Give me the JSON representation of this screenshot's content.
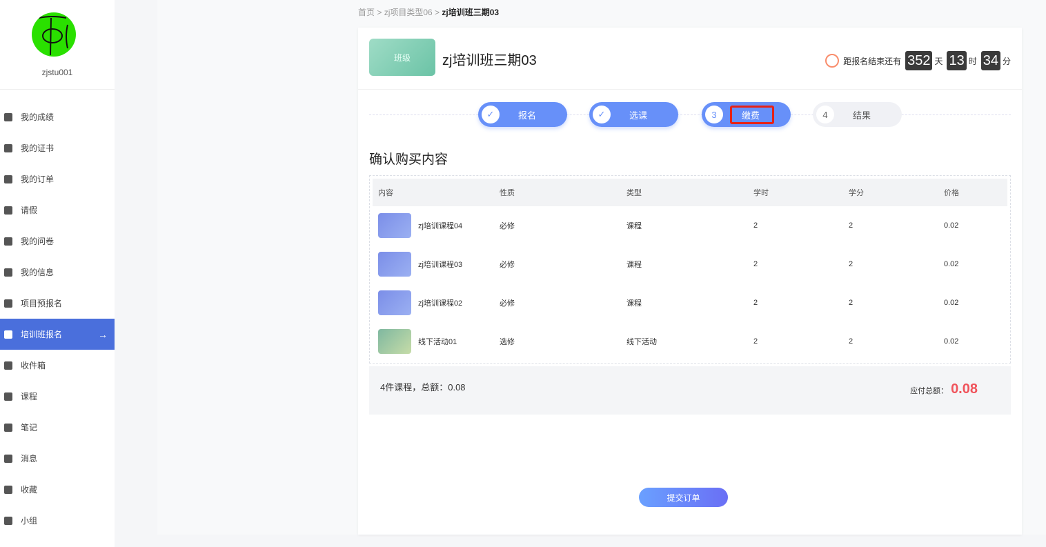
{
  "user": {
    "name": "zjstu001"
  },
  "sidebar": {
    "items": [
      {
        "label": "我的成绩"
      },
      {
        "label": "我的证书"
      },
      {
        "label": "我的订单"
      },
      {
        "label": "请假"
      },
      {
        "label": "我的问卷"
      },
      {
        "label": "我的信息"
      },
      {
        "label": "项目预报名"
      },
      {
        "label": "培训班报名",
        "active": true
      },
      {
        "label": "收件箱"
      },
      {
        "label": "课程"
      },
      {
        "label": "笔记"
      },
      {
        "label": "消息"
      },
      {
        "label": "收藏"
      },
      {
        "label": "小组"
      }
    ]
  },
  "breadcrumb": [
    "首页",
    "zj项目类型06",
    "zj培训班三期03"
  ],
  "class": {
    "thumb_label": "班级",
    "title": "zj培训班三期03"
  },
  "countdown": {
    "label": "距报名结束还有",
    "days": "352",
    "days_unit": "天",
    "hours": "13",
    "hours_unit": "时",
    "minutes": "34",
    "minutes_unit": "分"
  },
  "steps": [
    {
      "num": "✓",
      "label": "报名"
    },
    {
      "num": "✓",
      "label": "选课"
    },
    {
      "num": "3",
      "label": "缴费"
    },
    {
      "num": "4",
      "label": "结果"
    }
  ],
  "section_title": "确认购买内容",
  "table": {
    "headers": [
      "内容",
      "性质",
      "类型",
      "学时",
      "学分",
      "价格"
    ],
    "rows": [
      [
        "zj培训课程04",
        "必修",
        "课程",
        "2",
        "2",
        "0.02"
      ],
      [
        "zj培训课程03",
        "必修",
        "课程",
        "2",
        "2",
        "0.02"
      ],
      [
        "zj培训课程02",
        "必修",
        "课程",
        "2",
        "2",
        "0.02"
      ],
      [
        "线下活动01",
        "选修",
        "线下活动",
        "2",
        "2",
        "0.02"
      ]
    ]
  },
  "summary": {
    "left": "4件课程，总额：0.08",
    "payable_label": "应付总额：",
    "payable": "0.08"
  },
  "submit_label": "提交订单"
}
